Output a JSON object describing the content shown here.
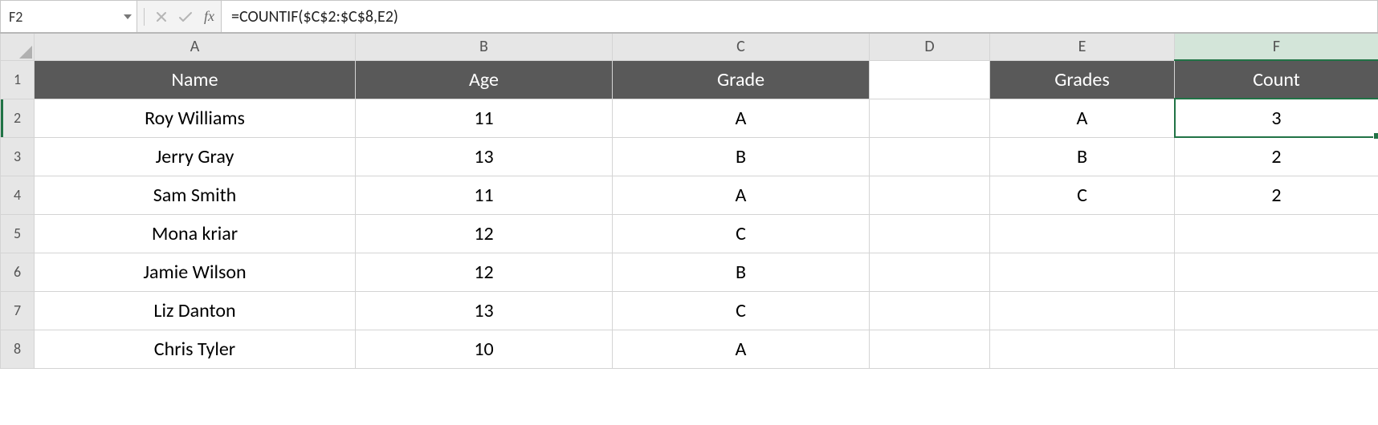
{
  "name_box": {
    "value": "F2"
  },
  "formula_bar": {
    "value": "=COUNTIF($C$2:$C$8,E2)"
  },
  "fx_label": "fx",
  "columns": {
    "A": "A",
    "B": "B",
    "C": "C",
    "D": "D",
    "E": "E",
    "F": "F"
  },
  "rows": {
    "r1": "1",
    "r2": "2",
    "r3": "3",
    "r4": "4",
    "r5": "5",
    "r6": "6",
    "r7": "7",
    "r8": "8"
  },
  "sheet": {
    "headers": {
      "name": "Name",
      "age": "Age",
      "grade": "Grade",
      "grades": "Grades",
      "count": "Count"
    },
    "data": {
      "r2": {
        "name": "Roy Williams",
        "age": "11",
        "grade": "A",
        "grades": "A",
        "count": "3"
      },
      "r3": {
        "name": "Jerry Gray",
        "age": "13",
        "grade": "B",
        "grades": "B",
        "count": "2"
      },
      "r4": {
        "name": "Sam Smith",
        "age": "11",
        "grade": "A",
        "grades": "C",
        "count": "2"
      },
      "r5": {
        "name": "Mona kriar",
        "age": "12",
        "grade": "C"
      },
      "r6": {
        "name": "Jamie Wilson",
        "age": "12",
        "grade": "B"
      },
      "r7": {
        "name": "Liz Danton",
        "age": "13",
        "grade": "C"
      },
      "r8": {
        "name": "Chris Tyler",
        "age": "10",
        "grade": "A"
      }
    }
  },
  "icons": {
    "cancel": "cancel-icon",
    "enter": "enter-icon",
    "fx": "fx-icon",
    "dropdown": "dropdown-icon"
  }
}
